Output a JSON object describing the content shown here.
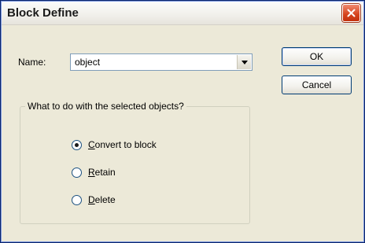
{
  "window": {
    "title": "Block Define"
  },
  "name_field": {
    "label": "Name:",
    "value": "object"
  },
  "buttons": {
    "ok_label": "OK",
    "cancel_label": "Cancel"
  },
  "group": {
    "legend": "What to do with the selected objects?",
    "options": [
      {
        "accel": "C",
        "rest": "onvert to block",
        "selected": true
      },
      {
        "accel": "R",
        "rest": "etain",
        "selected": false
      },
      {
        "accel": "D",
        "rest": "elete",
        "selected": false
      }
    ]
  },
  "icons": {
    "close": "close-icon",
    "dropdown": "chevron-down-icon"
  },
  "colors": {
    "close_button": "#d5431c",
    "dialog_bg": "#ece9d8",
    "input_border": "#7f9db9"
  }
}
